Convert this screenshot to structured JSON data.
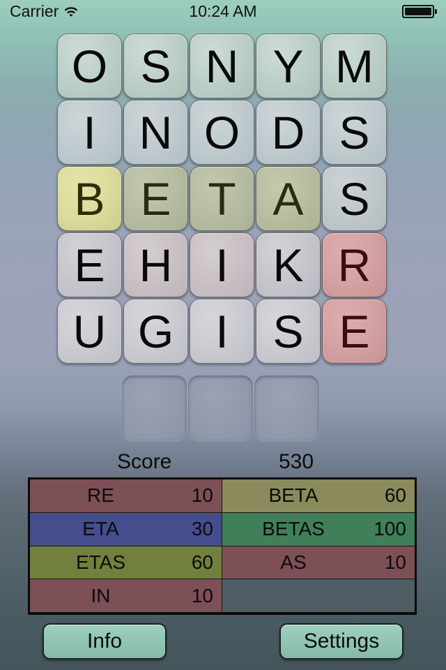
{
  "statusbar": {
    "carrier": "Carrier",
    "wifi_icon": "wifi-icon",
    "time": "10:24 AM",
    "battery_icon": "battery-icon"
  },
  "board": {
    "columns": 5,
    "rows": 5,
    "tiles": [
      [
        {
          "letter": "O",
          "state": "plain"
        },
        {
          "letter": "S",
          "state": "plain"
        },
        {
          "letter": "N",
          "state": "plain"
        },
        {
          "letter": "Y",
          "state": "plain"
        },
        {
          "letter": "M",
          "state": "plain"
        }
      ],
      [
        {
          "letter": "I",
          "state": "plain"
        },
        {
          "letter": "N",
          "state": "plain"
        },
        {
          "letter": "O",
          "state": "plain"
        },
        {
          "letter": "D",
          "state": "plain"
        },
        {
          "letter": "S",
          "state": "plain"
        }
      ],
      [
        {
          "letter": "B",
          "state": "bright-olive"
        },
        {
          "letter": "E",
          "state": "olive"
        },
        {
          "letter": "T",
          "state": "olive"
        },
        {
          "letter": "A",
          "state": "olive2"
        },
        {
          "letter": "S",
          "state": "plain"
        }
      ],
      [
        {
          "letter": "E",
          "state": "plain"
        },
        {
          "letter": "H",
          "state": "pinkish"
        },
        {
          "letter": "I",
          "state": "pinkish"
        },
        {
          "letter": "K",
          "state": "plain"
        },
        {
          "letter": "R",
          "state": "red"
        }
      ],
      [
        {
          "letter": "U",
          "state": "plain"
        },
        {
          "letter": "G",
          "state": "plain"
        },
        {
          "letter": "I",
          "state": "plain"
        },
        {
          "letter": "S",
          "state": "plain"
        },
        {
          "letter": "E",
          "state": "red"
        }
      ]
    ]
  },
  "staging": {
    "slot_count": 3,
    "slots": [
      "",
      "",
      ""
    ]
  },
  "score": {
    "label": "Score",
    "value": "530"
  },
  "words": {
    "rows": [
      [
        {
          "word": "RE",
          "points": "10",
          "color": "red"
        },
        {
          "word": "BETA",
          "points": "60",
          "color": "olive"
        }
      ],
      [
        {
          "word": "ETA",
          "points": "30",
          "color": "blue"
        },
        {
          "word": "BETAS",
          "points": "100",
          "color": "green"
        }
      ],
      [
        {
          "word": "ETAS",
          "points": "60",
          "color": "olive2"
        },
        {
          "word": "AS",
          "points": "10",
          "color": "red"
        }
      ],
      [
        {
          "word": "IN",
          "points": "10",
          "color": "red"
        },
        {
          "word": "",
          "points": "",
          "color": "empty"
        }
      ]
    ]
  },
  "footer": {
    "info_label": "Info",
    "settings_label": "Settings"
  },
  "colors": {
    "background_top": "#9ccdbe",
    "background_bottom": "#44555c",
    "button_mint": "#92c5b5",
    "word_red": "#7d4f56",
    "word_olive": "#8a8a5d",
    "word_blue": "#454d8e",
    "word_green": "#3f8059",
    "word_olive2": "#72803f",
    "word_empty": "#4e5d64",
    "tile_highlight_olive": "#dcdc9c",
    "tile_highlight_red": "#d4a2a2"
  }
}
